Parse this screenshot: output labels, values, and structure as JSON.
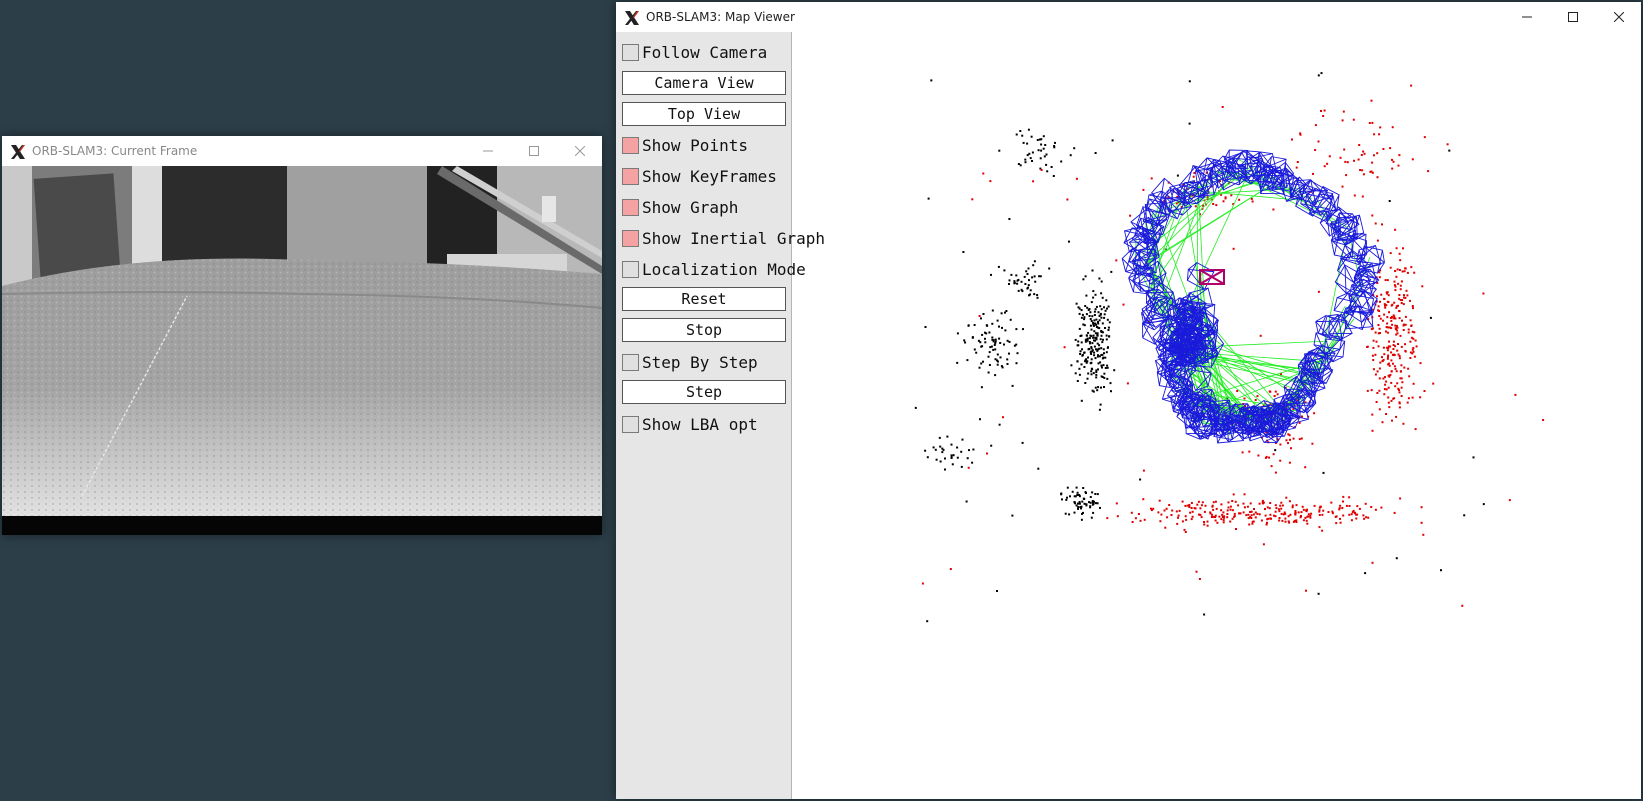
{
  "current_frame": {
    "title": "ORB-SLAM3: Current Frame",
    "controls": [
      "minimize-icon",
      "maximize-icon",
      "close-icon"
    ]
  },
  "map_viewer": {
    "title": "ORB-SLAM3: Map Viewer",
    "controls": [
      "minimize-icon",
      "maximize-icon",
      "close-icon"
    ],
    "panel": {
      "follow_camera": {
        "label": "Follow Camera",
        "checked": false
      },
      "camera_view": "Camera View",
      "top_view": "Top View",
      "show_points": {
        "label": "Show Points",
        "checked": true
      },
      "show_keyframes": {
        "label": "Show KeyFrames",
        "checked": true
      },
      "show_graph": {
        "label": "Show Graph",
        "checked": true
      },
      "show_inertial_graph": {
        "label": "Show Inertial Graph",
        "checked": true
      },
      "localization_mode": {
        "label": "Localization Mode",
        "checked": false
      },
      "reset": "Reset",
      "stop": "Stop",
      "step_by_step": {
        "label": "Step By Step",
        "checked": false
      },
      "step": "Step",
      "show_lba_opt": {
        "label": "Show LBA opt",
        "checked": false
      }
    },
    "map_colors": {
      "reference_points": "#e00000",
      "map_points": "#000000",
      "keyframes": "#1a1adb",
      "covisibility_graph": "#22ee22",
      "current_camera": "#b0006a"
    }
  }
}
